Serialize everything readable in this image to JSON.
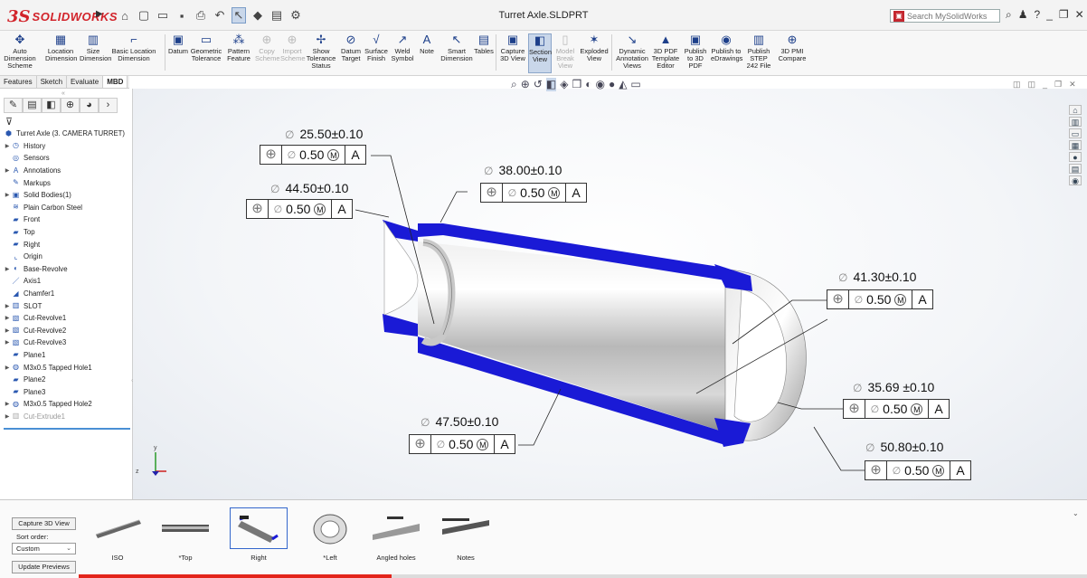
{
  "app": {
    "logo_ds": "3S",
    "logo_name": "SOLIDWORKS",
    "document_title": "Turret Axle.SLDPRT",
    "search_placeholder": "Search MySolidWorks"
  },
  "ribbon": [
    {
      "id": "auto-dimension-scheme",
      "label": "Auto Dimension Scheme",
      "icon": "auto-dimension-icon",
      "dim": false,
      "active": false
    },
    {
      "id": "location-dimension",
      "label": "Location Dimension",
      "icon": "location-dimension-icon",
      "dim": false,
      "active": false
    },
    {
      "id": "size-dimension",
      "label": "Size Dimension",
      "icon": "size-dimension-icon",
      "dim": false,
      "active": false
    },
    {
      "id": "basic-location-dimension",
      "label": "Basic Location Dimension",
      "icon": "basic-location-icon",
      "dim": false,
      "active": false
    },
    {
      "id": "datum",
      "label": "Datum",
      "icon": "datum-icon",
      "dim": false,
      "active": false
    },
    {
      "id": "geometric-tolerance",
      "label": "Geometric Tolerance",
      "icon": "geometric-tolerance-icon",
      "dim": false,
      "active": false
    },
    {
      "id": "pattern-feature",
      "label": "Pattern Feature",
      "icon": "pattern-feature-icon",
      "dim": false,
      "active": false
    },
    {
      "id": "copy-scheme",
      "label": "Copy Scheme",
      "icon": "copy-scheme-icon",
      "dim": true,
      "active": false
    },
    {
      "id": "import-scheme",
      "label": "Import Scheme",
      "icon": "import-scheme-icon",
      "dim": true,
      "active": false
    },
    {
      "id": "show-tolerance-status",
      "label": "Show Tolerance Status",
      "icon": "tolerance-status-icon",
      "dim": false,
      "active": false
    },
    {
      "id": "datum-target",
      "label": "Datum Target",
      "icon": "datum-target-icon",
      "dim": false,
      "active": false
    },
    {
      "id": "surface-finish",
      "label": "Surface Finish",
      "icon": "surface-finish-icon",
      "dim": false,
      "active": false
    },
    {
      "id": "weld-symbol",
      "label": "Weld Symbol",
      "icon": "weld-symbol-icon",
      "dim": false,
      "active": false
    },
    {
      "id": "note",
      "label": "Note",
      "icon": "note-icon",
      "dim": false,
      "active": false
    },
    {
      "id": "smart-dimension",
      "label": "Smart Dimension",
      "icon": "smart-dimension-icon",
      "dim": false,
      "active": false
    },
    {
      "id": "tables",
      "label": "Tables",
      "icon": "tables-icon",
      "dim": false,
      "active": false
    },
    {
      "id": "capture-3d-view",
      "label": "Capture 3D View",
      "icon": "camera-icon",
      "dim": false,
      "active": false
    },
    {
      "id": "section-view",
      "label": "Section View",
      "icon": "section-view-icon",
      "dim": false,
      "active": true
    },
    {
      "id": "model-break-view",
      "label": "Model Break View",
      "icon": "model-break-icon",
      "dim": true,
      "active": false
    },
    {
      "id": "exploded-view",
      "label": "Exploded View",
      "icon": "exploded-view-icon",
      "dim": false,
      "active": false
    },
    {
      "id": "dynamic-annotation-views",
      "label": "Dynamic Annotation Views",
      "icon": "annotation-views-icon",
      "dim": false,
      "active": false
    },
    {
      "id": "3d-pdf-template-editor",
      "label": "3D PDF Template Editor",
      "icon": "pdf-template-icon",
      "dim": false,
      "active": false
    },
    {
      "id": "publish-to-3d-pdf",
      "label": "Publish to 3D PDF",
      "icon": "publish-pdf-icon",
      "dim": false,
      "active": false
    },
    {
      "id": "publish-to-edrawings",
      "label": "Publish to eDrawings",
      "icon": "edrawings-icon",
      "dim": false,
      "active": false
    },
    {
      "id": "publish-step-242-file",
      "label": "Publish STEP 242 File",
      "icon": "step-file-icon",
      "dim": false,
      "active": false
    },
    {
      "id": "3d-pmi-compare",
      "label": "3D PMI Compare",
      "icon": "pmi-compare-icon",
      "dim": false,
      "active": false
    }
  ],
  "command_tabs": [
    "Features",
    "Sketch",
    "Evaluate",
    "MBD"
  ],
  "command_tab_active": "MBD",
  "tree": [
    {
      "label": "Turret Axle  (3. CAMERA TURRET)",
      "icon": "part-icon",
      "expand": false,
      "grey": false,
      "indent": 0
    },
    {
      "label": "History",
      "icon": "history-icon",
      "expand": true,
      "grey": false,
      "indent": 1
    },
    {
      "label": "Sensors",
      "icon": "sensors-icon",
      "expand": false,
      "grey": false,
      "indent": 1
    },
    {
      "label": "Annotations",
      "icon": "annotations-icon",
      "expand": true,
      "grey": false,
      "indent": 1
    },
    {
      "label": "Markups",
      "icon": "markups-icon",
      "expand": false,
      "grey": false,
      "indent": 1
    },
    {
      "label": "Solid Bodies(1)",
      "icon": "solid-bodies-icon",
      "expand": true,
      "grey": false,
      "indent": 1
    },
    {
      "label": "Plain Carbon Steel",
      "icon": "material-icon",
      "expand": false,
      "grey": false,
      "indent": 1
    },
    {
      "label": "Front",
      "icon": "plane-icon",
      "expand": false,
      "grey": false,
      "indent": 1
    },
    {
      "label": "Top",
      "icon": "plane-icon",
      "expand": false,
      "grey": false,
      "indent": 1
    },
    {
      "label": "Right",
      "icon": "plane-icon",
      "expand": false,
      "grey": false,
      "indent": 1
    },
    {
      "label": "Origin",
      "icon": "origin-icon",
      "expand": false,
      "grey": false,
      "indent": 1
    },
    {
      "label": "Base-Revolve",
      "icon": "revolve-icon",
      "expand": true,
      "grey": false,
      "indent": 1
    },
    {
      "label": "Axis1",
      "icon": "axis-icon",
      "expand": false,
      "grey": false,
      "indent": 1
    },
    {
      "label": "Chamfer1",
      "icon": "chamfer-icon",
      "expand": false,
      "grey": false,
      "indent": 1
    },
    {
      "label": "SLOT",
      "icon": "cut-extrude-icon",
      "expand": true,
      "grey": false,
      "indent": 1
    },
    {
      "label": "Cut-Revolve1",
      "icon": "cut-revolve-icon",
      "expand": true,
      "grey": false,
      "indent": 1
    },
    {
      "label": "Cut-Revolve2",
      "icon": "cut-revolve-icon",
      "expand": true,
      "grey": false,
      "indent": 1
    },
    {
      "label": "Cut-Revolve3",
      "icon": "cut-revolve-icon",
      "expand": true,
      "grey": false,
      "indent": 1
    },
    {
      "label": "Plane1",
      "icon": "plane-icon",
      "expand": false,
      "grey": false,
      "indent": 1
    },
    {
      "label": "M3x0.5 Tapped Hole1",
      "icon": "hole-wizard-icon",
      "expand": true,
      "grey": false,
      "indent": 1
    },
    {
      "label": "Plane2",
      "icon": "plane-icon",
      "expand": false,
      "grey": false,
      "indent": 1
    },
    {
      "label": "Plane3",
      "icon": "plane-icon",
      "expand": false,
      "grey": false,
      "indent": 1
    },
    {
      "label": "M3x0.5 Tapped Hole2",
      "icon": "hole-wizard-icon",
      "expand": true,
      "grey": false,
      "indent": 1
    },
    {
      "label": "Cut-Extrude1",
      "icon": "cut-extrude-icon",
      "expand": true,
      "grey": true,
      "indent": 1
    }
  ],
  "annotations": [
    {
      "id": "dim-25-50",
      "diameter": "25.50±0.10",
      "tolerance": "0.50",
      "modifier": "M",
      "datum": "A"
    },
    {
      "id": "dim-44-50",
      "diameter": "44.50±0.10",
      "tolerance": "0.50",
      "modifier": "M",
      "datum": "A"
    },
    {
      "id": "dim-38-00",
      "diameter": "38.00±0.10",
      "tolerance": "0.50",
      "modifier": "M",
      "datum": "A"
    },
    {
      "id": "dim-41-30",
      "diameter": "41.30±0.10",
      "tolerance": "0.50",
      "modifier": "M",
      "datum": "A"
    },
    {
      "id": "dim-35-69",
      "diameter": "35.69 ±0.10",
      "tolerance": "0.50",
      "modifier": "M",
      "datum": "A"
    },
    {
      "id": "dim-47-50",
      "diameter": "47.50±0.10",
      "tolerance": "0.50",
      "modifier": "M",
      "datum": "A"
    },
    {
      "id": "dim-50-80",
      "diameter": "50.80±0.10",
      "tolerance": "0.50",
      "modifier": "M",
      "datum": "A"
    }
  ],
  "triad": {
    "x": "x",
    "y": "y",
    "z": "z"
  },
  "views_pane": {
    "capture_button": "Capture 3D View",
    "sort_label": "Sort order:",
    "sort_value": "Custom",
    "update_button": "Update Previews",
    "thumbnails": [
      {
        "label": "ISO",
        "selected": false
      },
      {
        "label": "*Top",
        "selected": false
      },
      {
        "label": "Right",
        "selected": true
      },
      {
        "label": "*Left",
        "selected": false
      },
      {
        "label": "Angled holes",
        "selected": false
      },
      {
        "label": "Notes",
        "selected": false
      }
    ],
    "progress": 0.31
  },
  "colors": {
    "section_face": "#1a1ad6",
    "brand": "#d2232a",
    "selection": "#c9d7ea"
  }
}
